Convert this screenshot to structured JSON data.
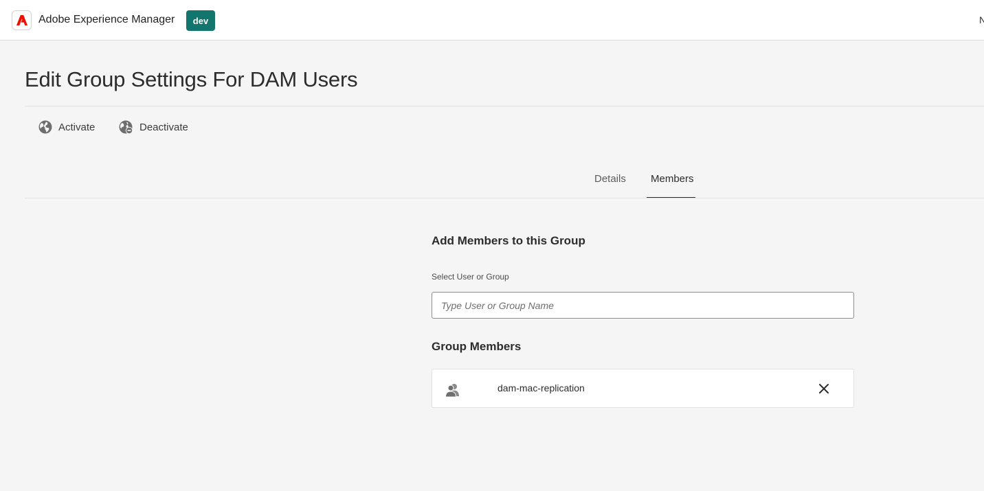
{
  "header": {
    "app_title": "Adobe Experience Manager",
    "env_badge": "dev",
    "edge_text": "N",
    "logo_icon": "adobe-logo-icon",
    "logo_color": "#eb1000",
    "badge_color": "#12766f"
  },
  "page": {
    "title": "Edit Group Settings For DAM Users"
  },
  "actions": {
    "activate_label": "Activate",
    "deactivate_label": "Deactivate",
    "activate_icon": "globe-icon",
    "deactivate_icon": "globe-minus-icon"
  },
  "tabs": [
    {
      "label": "Details",
      "active": false
    },
    {
      "label": "Members",
      "active": true
    }
  ],
  "members_panel": {
    "add_heading": "Add Members to this Group",
    "field_label": "Select User or Group",
    "search_placeholder": "Type User or Group Name",
    "search_value": "",
    "group_members_heading": "Group Members",
    "members": [
      {
        "name": "dam-mac-replication",
        "icon": "user-group-icon"
      }
    ],
    "remove_icon": "close-icon"
  }
}
